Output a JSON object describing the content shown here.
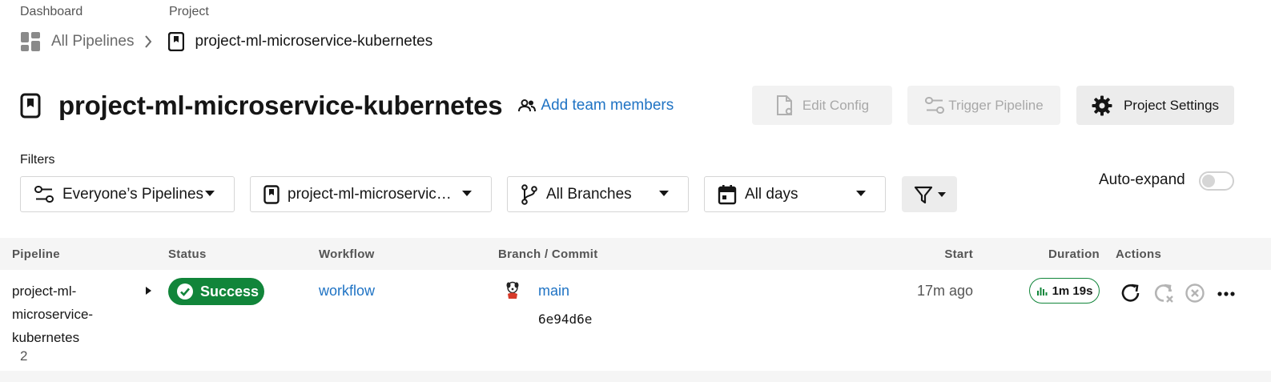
{
  "breadcrumb": {
    "dashboard_label": "Dashboard",
    "project_label": "Project",
    "all_pipelines": "All Pipelines",
    "project_name": "project-ml-microservice-kubernetes"
  },
  "header": {
    "title": "project-ml-microservice-kubernetes",
    "add_team_members": "Add team members",
    "edit_config": "Edit Config",
    "trigger_pipeline": "Trigger Pipeline",
    "project_settings": "Project Settings"
  },
  "filters": {
    "label": "Filters",
    "pipelines": "Everyone’s Pipelines",
    "project": "project-ml-microservic…",
    "branches": "All Branches",
    "days": "All days",
    "auto_expand": "Auto-expand",
    "auto_expand_on": false
  },
  "table": {
    "headers": {
      "pipeline": "Pipeline",
      "status": "Status",
      "workflow": "Workflow",
      "branch_commit": "Branch / Commit",
      "start": "Start",
      "duration": "Duration",
      "actions": "Actions"
    },
    "rows": [
      {
        "pipeline_name": "project-ml-microservice-kubernetes",
        "pipeline_number": "2",
        "status": "Success",
        "workflow": "workflow",
        "branch": "main",
        "commit": "6e94d6e",
        "start": "17m ago",
        "duration": "1m 19s"
      }
    ]
  },
  "colors": {
    "accent_link": "#1f73c4",
    "success": "#11853a",
    "disabled_text": "#a8a8a8"
  }
}
